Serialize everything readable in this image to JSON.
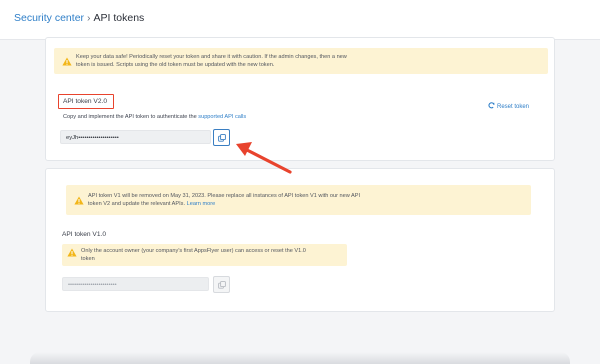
{
  "breadcrumb": {
    "parent": "Security center",
    "separator": "›",
    "current": "API tokens"
  },
  "top_warning": {
    "icon": "warning-triangle-icon",
    "line1": "Keep your data safe! Periodically reset your token and share it with caution. If the admin changes, then a new",
    "line2": "token is issued. Scripts using the old token must be updated with the new token."
  },
  "token_v2": {
    "label": "API token V2.0",
    "description": "Copy and implement the API token to authenticate the",
    "description_link": "supported API calls",
    "value": "eyJh••••••••••••••••••••",
    "copy_icon": "copy-icon",
    "reset_label": "Reset token",
    "reset_icon": "refresh-icon"
  },
  "v1_notice": {
    "icon": "warning-triangle-icon",
    "line1": "API token V1 will be removed on May 31, 2023. Please replace all instances of API token V1 with our new API",
    "line2": "token V2 and update the relevant APIs.",
    "link": "Learn more"
  },
  "token_v1": {
    "label": "API token V1.0",
    "warning_line1": "Only the account owner (your company's first AppsFlyer user) can access or reset the V1.0",
    "warning_line2": "token",
    "value": "••••••••••••••••••••••••",
    "copy_icon": "copy-icon"
  },
  "colors": {
    "accent": "#2f7fc8",
    "highlight": "#e8432d",
    "warning_bg": "#fdf3d3",
    "warning_icon": "#f2b619"
  }
}
